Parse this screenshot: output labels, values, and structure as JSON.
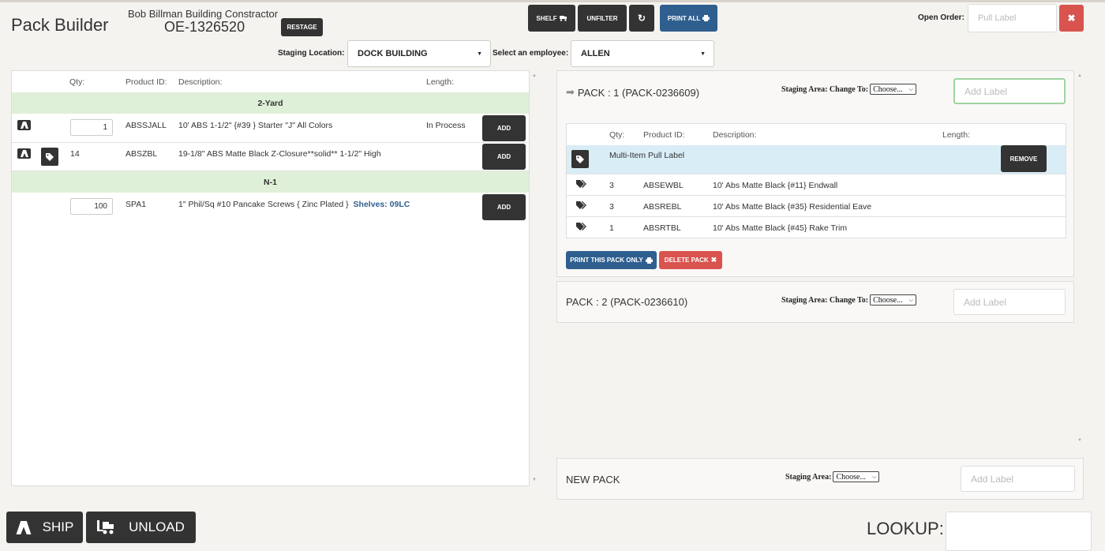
{
  "header": {
    "app_title": "Pack Builder",
    "customer_name": "Bob Billman Building Constractor",
    "order_number": "OE-1326520",
    "restage_label": "RESTAGE",
    "shelf_label": "SHELF",
    "unfilter_label": "UNFILTER",
    "print_all_label": "PRINT ALL",
    "open_order_label": "Open Order:",
    "pull_label_placeholder": "Pull Label"
  },
  "filters": {
    "staging_location_label": "Staging Location:",
    "staging_location_value": "DOCK BUILDING",
    "employee_label": "Select an employee:",
    "employee_value": "ALLEN"
  },
  "left_table": {
    "headers": {
      "qty": "Qty:",
      "product_id": "Product ID:",
      "description": "Description:",
      "length": "Length:"
    },
    "groups": [
      {
        "name": "2-Yard",
        "rows": [
          {
            "qty": "1",
            "qty_is_input": true,
            "product_id": "ABSSJALL",
            "description": "10' ABS 1-1/2\" {#39 } Starter \"J\" All Colors",
            "length": "In Process",
            "add_label": "ADD",
            "has_tag": false
          },
          {
            "qty": "14",
            "qty_is_input": false,
            "product_id": "ABSZBL",
            "description": "19-1/8\" ABS Matte Black Z-Closure**solid** 1-1/2\" High",
            "length": "",
            "add_label": "ADD",
            "has_tag": true
          }
        ]
      },
      {
        "name": "N-1",
        "rows": [
          {
            "qty": "100",
            "qty_is_input": true,
            "product_id": "SPA1",
            "description": "1\" Phil/Sq #10 Pancake Screws { Zinc Plated }",
            "shelves": "Shelves: 09LC",
            "length": "",
            "add_label": "ADD",
            "has_tag": false
          }
        ]
      }
    ]
  },
  "packs": [
    {
      "title": "PACK : 1 (PACK-0236609)",
      "staging_label": "Staging Area: Change To:",
      "staging_value": "Choose...",
      "label_placeholder": "Add Label",
      "headers": {
        "qty": "Qty:",
        "product_id": "Product ID:",
        "description": "Description:",
        "length": "Length:"
      },
      "multi_item_label": "Multi-Item Pull Label",
      "remove_label": "REMOVE",
      "items": [
        {
          "qty": "3",
          "product_id": "ABSEWBL",
          "description": "10' Abs Matte Black {#11} Endwall"
        },
        {
          "qty": "3",
          "product_id": "ABSREBL",
          "description": "10' Abs Matte Black {#35} Residential Eave"
        },
        {
          "qty": "1",
          "product_id": "ABSRTBL",
          "description": "10' Abs Matte Black {#45} Rake Trim"
        }
      ],
      "print_pack_label": "PRINT THIS PACK ONLY",
      "delete_pack_label": "DELETE PACK"
    },
    {
      "title": "PACK : 2 (PACK-0236610)",
      "staging_label": "Staging Area: Change To:",
      "staging_value": "Choose...",
      "label_placeholder": "Add Label"
    }
  ],
  "new_pack": {
    "title": "NEW PACK",
    "staging_label": "Staging Area:",
    "staging_value": "Choose...",
    "label_placeholder": "Add Label"
  },
  "footer": {
    "ship_label": "SHIP",
    "unload_label": "UNLOAD",
    "lookup_label": "LOOKUP:"
  },
  "colors": {
    "accent_blue": "#2f5f8f",
    "danger_red": "#d9534f",
    "dark": "#333333",
    "group_green": "#dff0d8",
    "selected_blue": "#d9edf7",
    "focus_green": "#9fd49f"
  },
  "icons": [
    "truck-icon",
    "tag-icon",
    "print-icon",
    "refresh-icon",
    "arrow-right-icon",
    "close-icon",
    "chevron-down-icon",
    "forklift-icon"
  ]
}
